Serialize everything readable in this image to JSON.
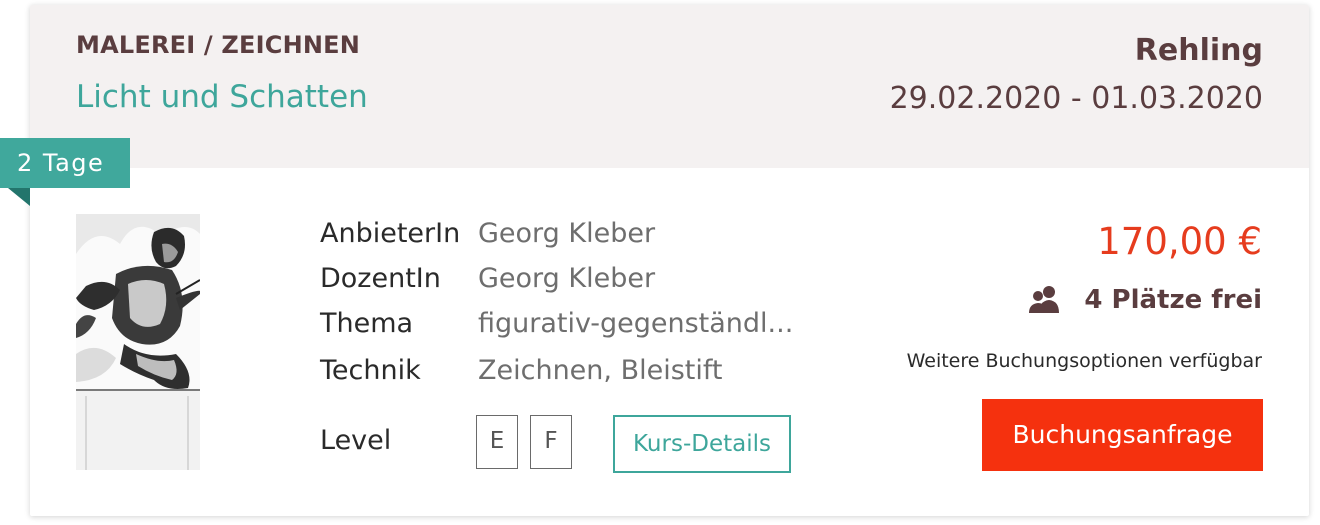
{
  "course": {
    "category": "MALEREI / ZEICHNEN",
    "title": "Licht und Schatten",
    "location": "Rehling",
    "dates": "29.02.2020 - 01.03.2020",
    "duration": "2 Tage"
  },
  "info": {
    "rows": [
      {
        "label": "AnbieterIn",
        "value": "Georg Kleber"
      },
      {
        "label": "DozentIn",
        "value": "Georg Kleber"
      },
      {
        "label": "Thema",
        "value": "figurativ-gegenständl..."
      },
      {
        "label": "Technik",
        "value": "Zeichnen, Bleistift"
      }
    ],
    "level_label": "Level",
    "levels": [
      "E",
      "F"
    ],
    "details_label": "Kurs-Details"
  },
  "booking": {
    "price": "170,00 €",
    "places": "4 Plätze frei",
    "places_icon": "people-icon",
    "options": "Weitere Buchungsoptionen verfügbar",
    "button_label": "Buchungsanfrage"
  },
  "colors": {
    "accent": "#3ea69b",
    "brown": "#5a3d3f",
    "price": "#e63c1e",
    "button": "#f5310e",
    "header_bg": "#f4f1f1"
  }
}
